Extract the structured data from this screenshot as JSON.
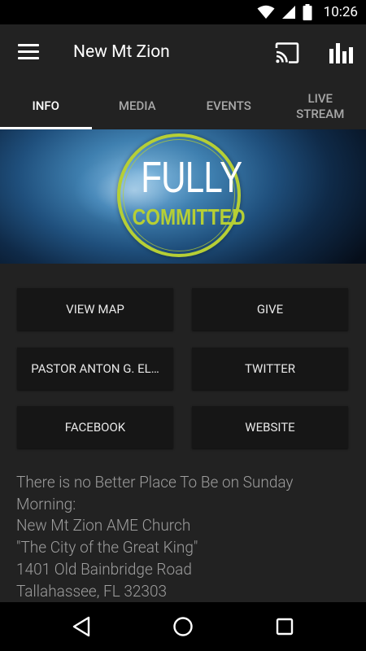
{
  "status_bar": {
    "time": "10:26",
    "icons": [
      "wifi-icon",
      "signal-icon",
      "battery-icon"
    ]
  },
  "app_bar": {
    "title": "New Mt Zion",
    "icons": [
      "menu-icon",
      "cast-icon",
      "bar-chart-icon"
    ]
  },
  "tabs": [
    {
      "label": "INFO",
      "active": true
    },
    {
      "label": "MEDIA",
      "active": false
    },
    {
      "label": "EVENTS",
      "active": false
    },
    {
      "label": "LIVE STREAM",
      "active": false
    }
  ],
  "banner": {
    "line1": "FULLY",
    "line2": "COMMITTED",
    "accent_color": "#b6cf35"
  },
  "buttons": [
    {
      "label": "VIEW MAP"
    },
    {
      "label": "GIVE"
    },
    {
      "label": "PASTOR ANTON G. EL…"
    },
    {
      "label": "TWITTER"
    },
    {
      "label": "FACEBOOK"
    },
    {
      "label": "WEBSITE"
    }
  ],
  "info": {
    "lines": [
      "There is no Better Place To Be on Sunday",
      "Morning:",
      "New Mt Zion AME Church",
      "\"The City of the Great King\"",
      "1401 Old Bainbridge Road",
      "Tallahassee, FL 32303"
    ]
  },
  "nav_bar": {
    "icons": [
      "back-icon",
      "home-icon",
      "recents-icon"
    ]
  },
  "colors": {
    "background": "#222222",
    "button_bg": "#161616",
    "text_muted": "#9e9e9e"
  }
}
